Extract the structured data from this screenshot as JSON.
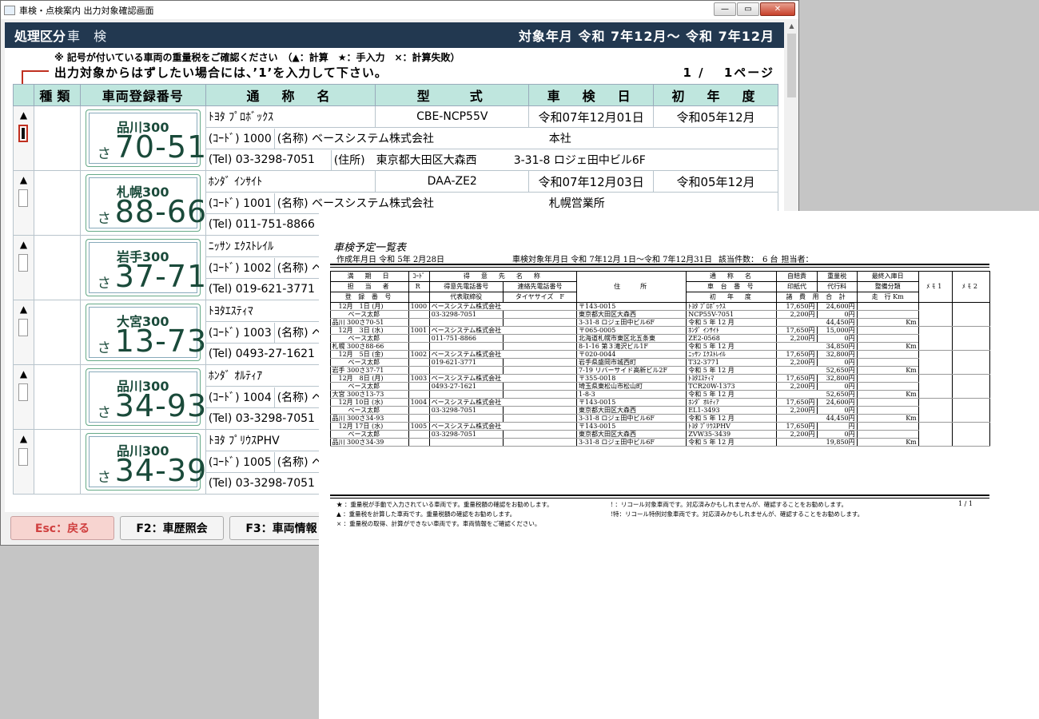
{
  "window": {
    "title": "車検・点検案内 出力対象確認画面",
    "controls": [
      "—",
      "▭",
      "✕"
    ]
  },
  "header": {
    "proc_label": "処理区分",
    "proc_value": "車 検",
    "period": "対象年月 令和 7年12月～ 令和 7年12月"
  },
  "notes": {
    "legend": "※ 記号が付いている車両の重量税をご確認ください　（▲：計算　★：手入力　×：計算失敗）",
    "instruction": "出力対象からはずしたい場合には、’1’を入力して下さい。",
    "page": "1 /　 1ページ"
  },
  "columns": [
    "",
    "種類",
    "車両登録番号",
    "通　称　名",
    "型　　式",
    "車　検　日",
    "初　年　度"
  ],
  "vehicles": [
    {
      "mark": "▲",
      "plate_top": "品川300",
      "plate_kana": "さ",
      "plate_num": "70-51",
      "name": "ﾄﾖﾀ ﾌﾟﾛﾎﾞｯｸｽ",
      "model": "CBE-NCP55V",
      "inspection": "令和07年12月01日",
      "first_year": "令和05年12月",
      "code": "(ｺｰﾄﾞ) 1000",
      "company": "(名称) ベースシステム株式会社",
      "branch": "本社",
      "tel": "(Tel) 03-3298-7051",
      "address": "(住所)　東京都大田区大森西",
      "address2": "3-31-8 ロジェ田中ビル6F"
    },
    {
      "mark": "▲",
      "plate_top": "札幌300",
      "plate_kana": "さ",
      "plate_num": "88-66",
      "name": "ﾎﾝﾀﾞ ｲﾝｻｲﾄ",
      "model": "DAA-ZE2",
      "inspection": "令和07年12月03日",
      "first_year": "令和05年12月",
      "code": "(ｺｰﾄﾞ) 1001",
      "company": "(名称) ベースシステム株式会社",
      "branch": "札幌営業所",
      "tel": "(Tel) 011-751-8866",
      "address": "",
      "address2": ""
    },
    {
      "mark": "▲",
      "plate_top": "岩手300",
      "plate_kana": "さ",
      "plate_num": "37-71",
      "name": "ﾆｯｻﾝ ｴｸｽﾄﾚｲﾙ",
      "model": "",
      "inspection": "",
      "first_year": "",
      "code": "(ｺｰﾄﾞ) 1002",
      "company": "(名称) ベ",
      "branch": "",
      "tel": "(Tel) 019-621-3771",
      "address": "",
      "address2": ""
    },
    {
      "mark": "▲",
      "plate_top": "大宮300",
      "plate_kana": "さ",
      "plate_num": "13-73",
      "name": "ﾄﾖﾀｴｽﾃｨﾏ",
      "model": "",
      "inspection": "",
      "first_year": "",
      "code": "(ｺｰﾄﾞ) 1003",
      "company": "(名称) ベ",
      "branch": "",
      "tel": "(Tel) 0493-27-1621",
      "address": "",
      "address2": ""
    },
    {
      "mark": "▲",
      "plate_top": "品川300",
      "plate_kana": "さ",
      "plate_num": "34-93",
      "name": "ﾎﾝﾀﾞ ｵﾙﾃｨｱ",
      "model": "",
      "inspection": "",
      "first_year": "",
      "code": "(ｺｰﾄﾞ) 1004",
      "company": "(名称) ベ",
      "branch": "",
      "tel": "(Tel) 03-3298-7051",
      "address": "",
      "address2": ""
    },
    {
      "mark": "▲",
      "plate_top": "品川300",
      "plate_kana": "さ",
      "plate_num": "34-39",
      "name": "ﾄﾖﾀ ﾌﾟﾘｳｽPHV",
      "model": "",
      "inspection": "",
      "first_year": "",
      "code": "(ｺｰﾄﾞ) 1005",
      "company": "(名称) ベ",
      "branch": "",
      "tel": "(Tel) 03-3298-7051",
      "address": "",
      "address2": ""
    }
  ],
  "buttons": {
    "esc": "Esc：戻る",
    "f2": "F2：車歴照会",
    "f3": "F3：車両情報"
  },
  "report": {
    "title": "車検予定一覧表",
    "created": "作成年月日 令和 5年 2月28日",
    "target": "車検対象年月日 令和 7年12月 1日～令和 7年12月31日",
    "count": "該当件数：　6 台",
    "person": "担当者：",
    "head1": [
      "満　期　日",
      "ｺｰﾄﾞ",
      "得　意　先　名　称",
      "",
      "住　　所",
      "通　称　名",
      "自賠責",
      "重量税",
      "最終入庫日",
      "ﾒﾓ1",
      "ﾒﾓ2"
    ],
    "head2": [
      "担　当　者",
      "R",
      "得意先電話番号",
      "連絡先電話番号",
      "",
      "車 台 番 号",
      "印紙代",
      "代行料",
      "整備分類"
    ],
    "head3": [
      "登 録 番 号",
      "",
      "代表取締役",
      "タイヤサイズ　F",
      "",
      "初　年　度",
      "諸 費 用 合 計",
      "",
      "走　行 Km"
    ],
    "rows": [
      {
        "date": "12月　1日 (月)",
        "code": "1000",
        "customer": "ベースシステム株式会社",
        "staff": "ベース太郎",
        "tel": "03-3298-7051",
        "plate": "品川 300さ70-51",
        "zip": "〒143-0015",
        "addr1": "東京都大田区大森西",
        "addr2": "3-31-8 ロジェ田中ビル6F",
        "name": "ﾄﾖﾀ ﾌﾟﾛﾎﾞｯｸｽ",
        "chassis": "NCP55V-7051",
        "first": "令和 5 年 12 月",
        "jibai": "17,650円",
        "weight": "24,600円",
        "stamp": "2,200円",
        "agency": "0円",
        "total": "44,450円",
        "km": "Km"
      },
      {
        "date": "12月　3日 (水)",
        "code": "1001",
        "customer": "ベースシステム株式会社",
        "staff": "ベース太郎",
        "tel": "011-751-8866",
        "plate": "札幌 300さ88-66",
        "zip": "〒065-0005",
        "addr1": "北海道札幌市東区北五条東",
        "addr2": "8-1-16 第３滝沢ビル1F",
        "name": "ﾎﾝﾀﾞ ｲﾝｻｲﾄ",
        "chassis": "ZE2-0568",
        "first": "令和 5 年 12 月",
        "jibai": "17,650円",
        "weight": "15,000円",
        "stamp": "2,200円",
        "agency": "0円",
        "total": "34,850円",
        "km": "Km"
      },
      {
        "date": "12月　5日 (金)",
        "code": "1002",
        "customer": "ベースシステム株式会社",
        "staff": "ベース太郎",
        "tel": "019-621-3771",
        "plate": "岩手 300さ37-71",
        "zip": "〒020-0044",
        "addr1": "岩手県盛岡市城西町",
        "addr2": "7-19 リバーサイド高新ビル2F",
        "name": "ﾆｯｻﾝ ｴｸｽﾄﾚｲﾙ",
        "chassis": "T32-3771",
        "first": "令和 5 年 12 月",
        "jibai": "17,650円",
        "weight": "32,800円",
        "stamp": "2,200円",
        "agency": "0円",
        "total": "52,650円",
        "km": "Km"
      },
      {
        "date": "12月　8日 (月)",
        "code": "1003",
        "customer": "ベースシステム株式会社",
        "staff": "ベース太郎",
        "tel": "0493-27-1621",
        "plate": "大宮 300さ13-73",
        "zip": "〒355-0018",
        "addr1": "埼玉県東松山市松山町",
        "addr2": "1-8-3",
        "name": "ﾄﾖﾀｴｽﾃｨﾏ",
        "chassis": "TCR20W-1373",
        "first": "令和 5 年 12 月",
        "jibai": "17,650円",
        "weight": "32,800円",
        "stamp": "2,200円",
        "agency": "0円",
        "total": "52,650円",
        "km": "Km"
      },
      {
        "date": "12月 10日 (水)",
        "code": "1004",
        "customer": "ベースシステム株式会社",
        "staff": "ベース太郎",
        "tel": "03-3298-7051",
        "plate": "品川 300さ34-93",
        "zip": "〒143-0015",
        "addr1": "東京都大田区大森西",
        "addr2": "3-31-8 ロジェ田中ビル6F",
        "name": "ﾎﾝﾀﾞ ｵﾙﾃｨｱ",
        "chassis": "EL1-3493",
        "first": "令和 5 年 12 月",
        "jibai": "17,650円",
        "weight": "24,600円",
        "stamp": "2,200円",
        "agency": "0円",
        "total": "44,450円",
        "km": "Km"
      },
      {
        "date": "12月 17日 (水)",
        "code": "1005",
        "customer": "ベースシステム株式会社",
        "staff": "ベース太郎",
        "tel": "03-3298-7051",
        "plate": "品川 300さ34-39",
        "zip": "〒143-0015",
        "addr1": "東京都大田区大森西",
        "addr2": "3-31-8 ロジェ田中ビル6F",
        "name": "ﾄﾖﾀ ﾌﾟﾘｳｽPHV",
        "chassis": "ZVW35-3439",
        "first": "令和 5 年 12 月",
        "jibai": "17,650円",
        "weight": "円",
        "stamp": "2,200円",
        "agency": "0円",
        "total": "19,850円",
        "km": "Km"
      }
    ],
    "foot_left": [
      "★ ：重量税が手動で入力されている車両です。重量税額の確認をお勧めします。",
      "▲ ：重量税を計算した車両です。重量税額の確認をお勧めします。",
      "× ：重量税の取得、計算ができない車両です。車両情報をご確認ください。"
    ],
    "foot_right": [
      "! ：リコール対象車両です。対応済みかもしれませんが、確認することをお勧めします。",
      "!特：リコール特例対象車両です。対応済みかもしれませんが、確認することをお勧めします。"
    ],
    "page": "1 / 1",
    "mark": "▲"
  }
}
